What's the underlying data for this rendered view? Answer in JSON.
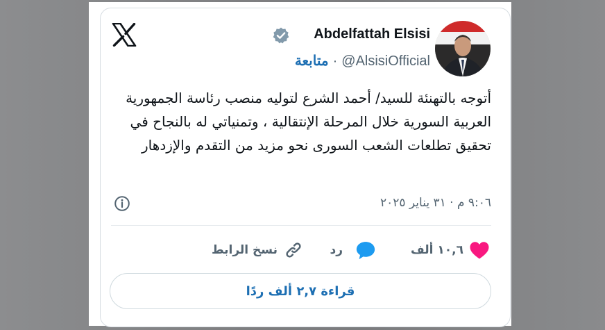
{
  "author": {
    "display_name": "Abdelfattah Elsisi",
    "handle": "@AlsisiOfficial",
    "follow_label": "متابعة",
    "separator": "·"
  },
  "tweet": {
    "text": "أتوجه بالتهنئة للسيد/ أحمد الشرع لتوليه منصب رئاسة الجمهورية العربية السورية خلال المرحلة الإنتقالية ، وتمنياتي له بالنجاح في تحقيق تطلعات الشعب السورى نحو مزيد من التقدم والإزدهار",
    "timestamp": "٩:٠٦ م · ٣١ يناير ٢٠٢٥"
  },
  "actions": {
    "like_count": "١٠,٦ ألف",
    "reply_label": "رد",
    "copy_link_label": "نسخ الرابط"
  },
  "read_replies_label": "قراءة ٢,٧ ألف ردًا",
  "icons": {
    "logo": "x-logo-icon",
    "verified": "verified-badge-icon",
    "info": "info-icon",
    "like": "heart-icon",
    "reply": "speech-bubble-icon",
    "link": "link-icon"
  },
  "colors": {
    "like": "#f91880",
    "reply": "#1d9bf0",
    "link_text": "#1d6fb3",
    "verified_badge": "#829aab"
  }
}
